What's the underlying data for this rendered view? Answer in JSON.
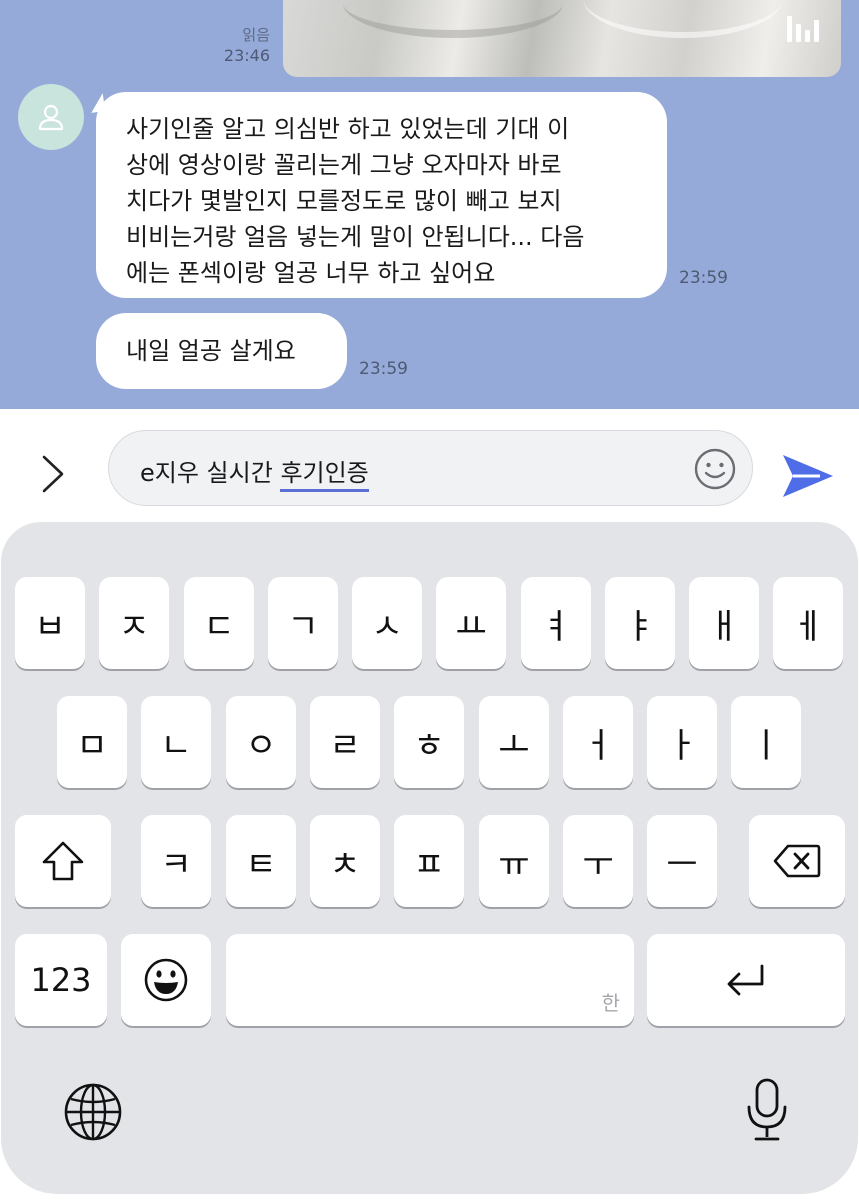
{
  "chat": {
    "media_status": "읽음",
    "media_time": "23:46",
    "messages": [
      {
        "lines": [
          "사기인줄 알고 의심반 하고 있었는데 기대 이",
          "상에 영상이랑 꼴리는게 그냥 오자마자 바로",
          "치다가 몇발인지 모를정도로 많이 빼고 보지",
          "비비는거랑 얼음 넣는게 말이 안됩니다... 다음",
          "에는 폰섹이랑 얼공 너무 하고 싶어요"
        ],
        "time": "23:59"
      },
      {
        "text": "내일 얼공 살게요",
        "time": "23:59"
      }
    ]
  },
  "input": {
    "text_committed": "e지우 실시간 ",
    "text_composing": "후기인증"
  },
  "keyboard": {
    "row1": [
      "ㅂ",
      "ㅈ",
      "ㄷ",
      "ㄱ",
      "ㅅ",
      "ㅛ",
      "ㅕ",
      "ㅑ",
      "ㅐ",
      "ㅔ"
    ],
    "row2": [
      "ㅁ",
      "ㄴ",
      "ㅇ",
      "ㄹ",
      "ㅎ",
      "ㅗ",
      "ㅓ",
      "ㅏ",
      "ㅣ"
    ],
    "row3": [
      "ㅋ",
      "ㅌ",
      "ㅊ",
      "ㅍ",
      "ㅠ",
      "ㅜ",
      "ㅡ"
    ],
    "numbers_label": "123",
    "space_hint": "한"
  },
  "colors": {
    "chat_background": "#95aad8",
    "send_accent": "#4f6de6",
    "avatar_background": "#c9e4dd",
    "keyboard_background": "#e3e4e8"
  }
}
